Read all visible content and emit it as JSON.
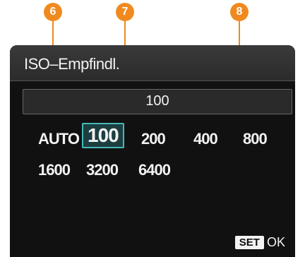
{
  "callouts": [
    "6",
    "7",
    "8"
  ],
  "menu": {
    "title": "ISO–Empfindl.",
    "current_value": "100",
    "options_row1": [
      "AUTO",
      "100",
      "200",
      "400",
      "800"
    ],
    "options_row2": [
      "1600",
      "3200",
      "6400"
    ],
    "selected": "100",
    "footer": {
      "set_label": "SET",
      "ok_label": "OK"
    }
  },
  "colors": {
    "accent": "#48b7b7",
    "callout": "#f08a1f"
  }
}
